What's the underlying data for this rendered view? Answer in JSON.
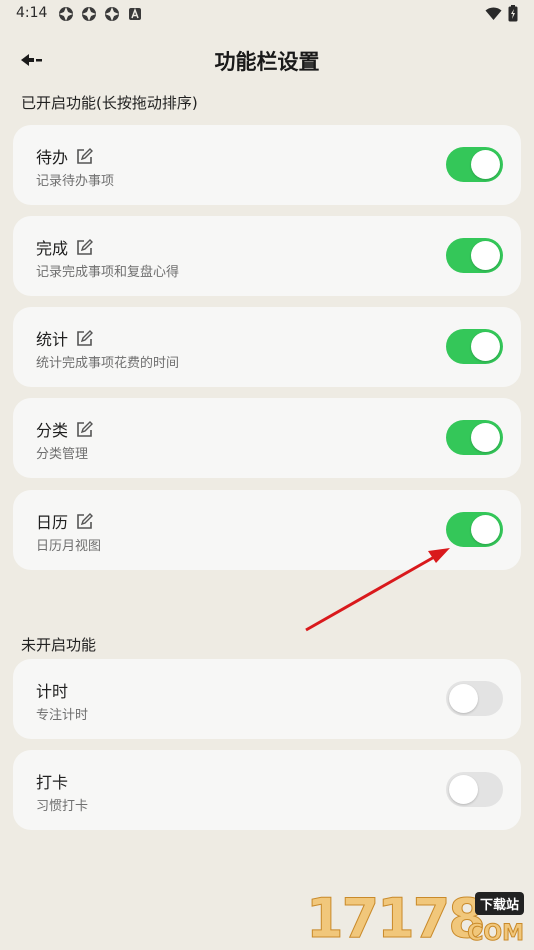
{
  "status_bar": {
    "time": "4:14",
    "notification_icons": [
      "app-icon",
      "app-icon",
      "app-icon",
      "a-badge-icon"
    ],
    "right_icons": [
      "wifi-icon",
      "battery-icon"
    ]
  },
  "header": {
    "title": "功能栏设置",
    "back_icon": "back-arrow-icon"
  },
  "enabled_section": {
    "label": "已开启功能(长按拖动排序)",
    "items": [
      {
        "title": "待办",
        "desc": "记录待办事项",
        "enabled": true
      },
      {
        "title": "完成",
        "desc": "记录完成事项和复盘心得",
        "enabled": true
      },
      {
        "title": "统计",
        "desc": "统计完成事项花费的时间",
        "enabled": true
      },
      {
        "title": "分类",
        "desc": "分类管理",
        "enabled": true
      },
      {
        "title": "日历",
        "desc": "日历月视图",
        "enabled": true
      }
    ]
  },
  "disabled_section": {
    "label": "未开启功能",
    "items": [
      {
        "title": "计时",
        "desc": "专注计时",
        "enabled": false
      },
      {
        "title": "打卡",
        "desc": "习惯打卡",
        "enabled": false
      }
    ]
  },
  "watermark": {
    "digits": "17178",
    "badge": "下载站",
    "suffix": "COM"
  },
  "colors": {
    "background": "#eeebe3",
    "card": "#f7f7f6",
    "toggle_on": "#34c759",
    "toggle_off": "#e3e3e3",
    "annotation_arrow": "#d9191c"
  }
}
